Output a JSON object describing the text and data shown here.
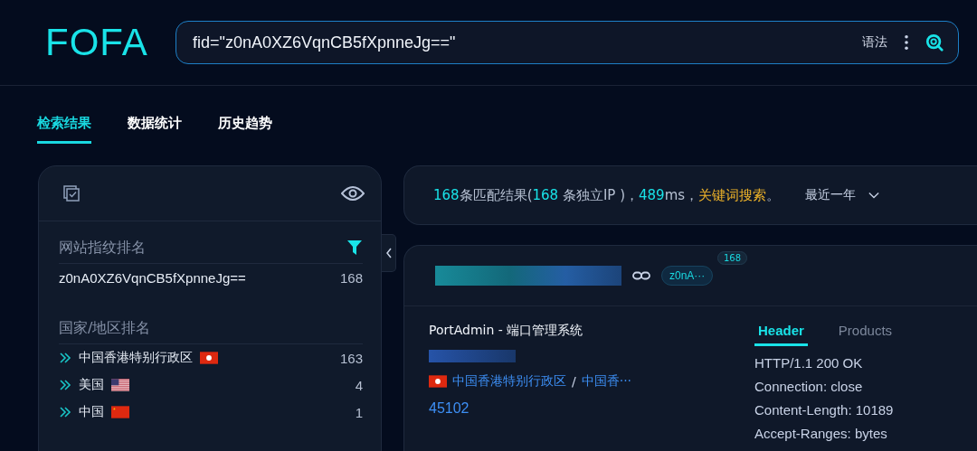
{
  "header": {
    "logo": "FOFA",
    "search": {
      "value": "fid=\"z0nA0XZ6VqnCB5fXpnneJg==\""
    },
    "syntax_label": "语法"
  },
  "tabs": [
    {
      "label": "检索结果",
      "selected": true
    },
    {
      "label": "数据统计",
      "selected": false
    },
    {
      "label": "历史趋势",
      "selected": false
    }
  ],
  "sidebar": {
    "fingerprint_title": "网站指纹排名",
    "fingerprints": [
      {
        "name": "z0nA0XZ6VqnCB5fXpnneJg==",
        "count": "168"
      }
    ],
    "country_title": "国家/地区排名",
    "countries": [
      {
        "name": "中国香港特别行政区",
        "kind": "hk",
        "count": "163"
      },
      {
        "name": "美国",
        "kind": "us",
        "count": "4"
      },
      {
        "name": "中国",
        "kind": "cn",
        "count": "1"
      }
    ]
  },
  "summary": {
    "parts": [
      {
        "kind": "number",
        "text": "168"
      },
      {
        "kind": "text",
        "text": "条匹配结果("
      },
      {
        "kind": "number",
        "text": "168"
      },
      {
        "kind": "text",
        "text": " 条独立IP )，"
      },
      {
        "kind": "number",
        "text": "489"
      },
      {
        "kind": "text",
        "text": "ms，"
      },
      {
        "kind": "link",
        "text": "关键词搜索"
      },
      {
        "kind": "text",
        "text": "。"
      }
    ],
    "range": "最近一年"
  },
  "result": {
    "tag": "z0nA···",
    "tag_count": "168",
    "title": "PortAdmin - 端口管理系统",
    "location": {
      "kind": "hk",
      "region": "中国香港特别行政区",
      "separator": "/",
      "city": "中国香···"
    },
    "asn": "45102",
    "detail_tabs": [
      {
        "label": "Header",
        "selected": true
      },
      {
        "label": "Products",
        "selected": false
      }
    ],
    "header_lines": [
      "HTTP/1.1 200 OK",
      "Connection: close",
      "Content-Length: 10189",
      "Accept-Ranges: bytes"
    ]
  }
}
